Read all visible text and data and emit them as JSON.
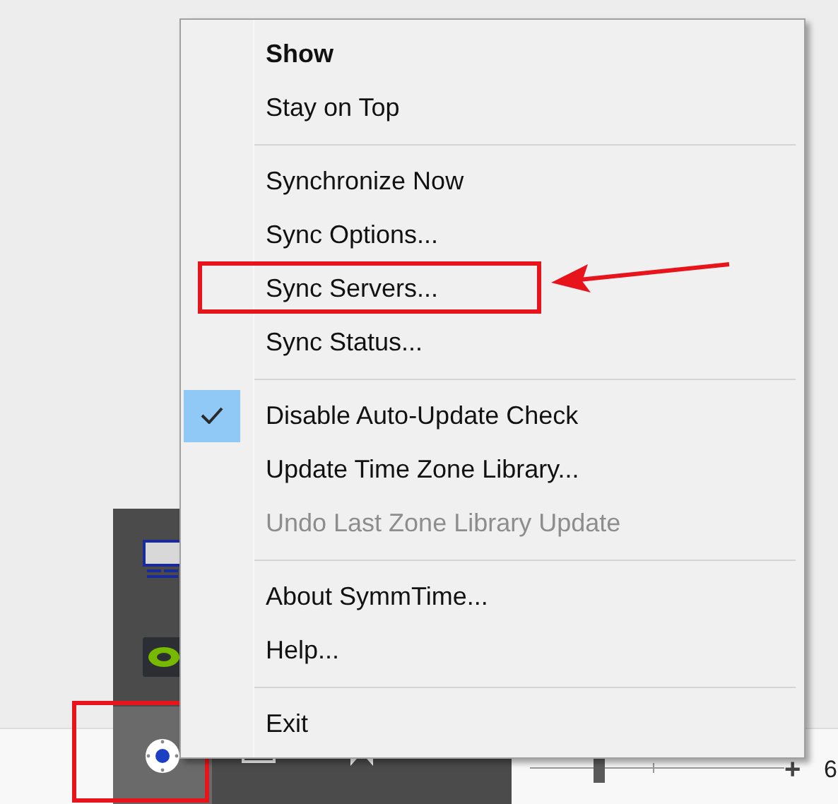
{
  "menu": {
    "items": [
      {
        "kind": "item",
        "label": "Show",
        "bold": true,
        "checked": false,
        "disabled": false,
        "highlighted": false
      },
      {
        "kind": "item",
        "label": "Stay on Top",
        "bold": false,
        "checked": false,
        "disabled": false,
        "highlighted": false
      },
      {
        "kind": "separator"
      },
      {
        "kind": "item",
        "label": "Synchronize Now",
        "bold": false,
        "checked": false,
        "disabled": false,
        "highlighted": false
      },
      {
        "kind": "item",
        "label": "Sync Options...",
        "bold": false,
        "checked": false,
        "disabled": false,
        "highlighted": false
      },
      {
        "kind": "item",
        "label": "Sync Servers...",
        "bold": false,
        "checked": false,
        "disabled": false,
        "highlighted": true
      },
      {
        "kind": "item",
        "label": "Sync Status...",
        "bold": false,
        "checked": false,
        "disabled": false,
        "highlighted": false
      },
      {
        "kind": "separator"
      },
      {
        "kind": "item",
        "label": "Disable Auto-Update Check",
        "bold": false,
        "checked": true,
        "disabled": false,
        "highlighted": false
      },
      {
        "kind": "item",
        "label": "Update Time Zone Library...",
        "bold": false,
        "checked": false,
        "disabled": false,
        "highlighted": false
      },
      {
        "kind": "item",
        "label": "Undo Last Zone Library Update",
        "bold": false,
        "checked": false,
        "disabled": true,
        "highlighted": false
      },
      {
        "kind": "separator"
      },
      {
        "kind": "item",
        "label": "About SymmTime...",
        "bold": false,
        "checked": false,
        "disabled": false,
        "highlighted": false
      },
      {
        "kind": "item",
        "label": "Help...",
        "bold": false,
        "checked": false,
        "disabled": false,
        "highlighted": false
      },
      {
        "kind": "separator"
      },
      {
        "kind": "item",
        "label": "Exit",
        "bold": false,
        "checked": false,
        "disabled": false,
        "highlighted": false
      }
    ]
  },
  "tray": {
    "icons": [
      {
        "kind": "monitor",
        "highlighted": false
      },
      {
        "kind": "gpu",
        "highlighted": false
      },
      {
        "kind": "clock",
        "highlighted": true
      }
    ],
    "bottom_icons": [
      {
        "kind": "printer"
      },
      {
        "kind": "bookmark"
      }
    ]
  },
  "status_bar": {
    "zoom_slider": {
      "level": 0.27,
      "plus": "+"
    },
    "zoom_text": "6"
  }
}
